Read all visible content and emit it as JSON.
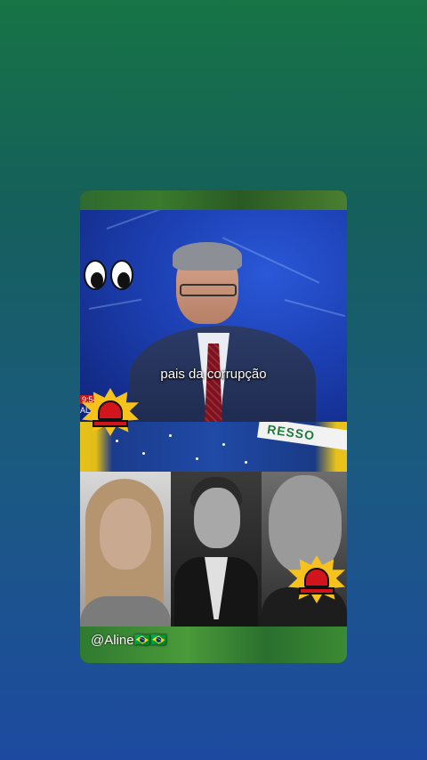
{
  "video": {
    "caption": "pais da corrupção",
    "handle": "@Aline🇧🇷🇧🇷",
    "tv_clock": "9:54",
    "tv_tag": "AL",
    "flag_band_text": "RESSO"
  },
  "stickers": {
    "eyes": "eyes-emoji",
    "siren": "police-light-emoji"
  },
  "colors": {
    "background_top": "#167445",
    "background_bottom": "#1d4aa0",
    "studio_blue": "#1c3fb2",
    "siren_red": "#d2141c",
    "burst_yellow": "#f6c21b"
  }
}
